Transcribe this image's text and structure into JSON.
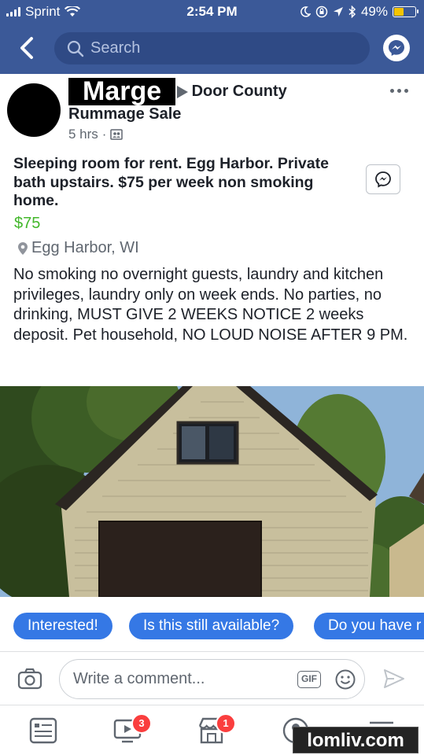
{
  "status_bar": {
    "carrier": "Sprint",
    "time": "2:54 PM",
    "battery": "49%"
  },
  "nav": {
    "search_placeholder": "Search"
  },
  "post": {
    "author": "Marge",
    "group_line1": "Door County",
    "group_line2": "Rummage Sale",
    "time_ago": "5 hrs",
    "title": "Sleeping room for rent. Egg Harbor. Private bath upstairs. $75 per week non smoking home.",
    "price": "$75",
    "location": "Egg Harbor, WI",
    "description": "No smoking no overnight guests, laundry and kitchen privileges, laundry only on week ends. No parties, no drinking, MUST GIVE 2 WEEKS NOTICE 2 weeks deposit. Pet household, NO LOUD NOISE AFTER 9 PM."
  },
  "quick_replies": [
    "Interested!",
    "Is this still available?",
    "Do you have r"
  ],
  "comment": {
    "placeholder": "Write a comment...",
    "gif_label": "GIF"
  },
  "tabbar": {
    "video_badge": "3",
    "marketplace_badge": "1"
  },
  "watermark": "lomliv.com",
  "colors": {
    "brand": "#3b5998",
    "chip": "#3578e5",
    "price": "#42b72a",
    "badge": "#fa3e3e"
  }
}
